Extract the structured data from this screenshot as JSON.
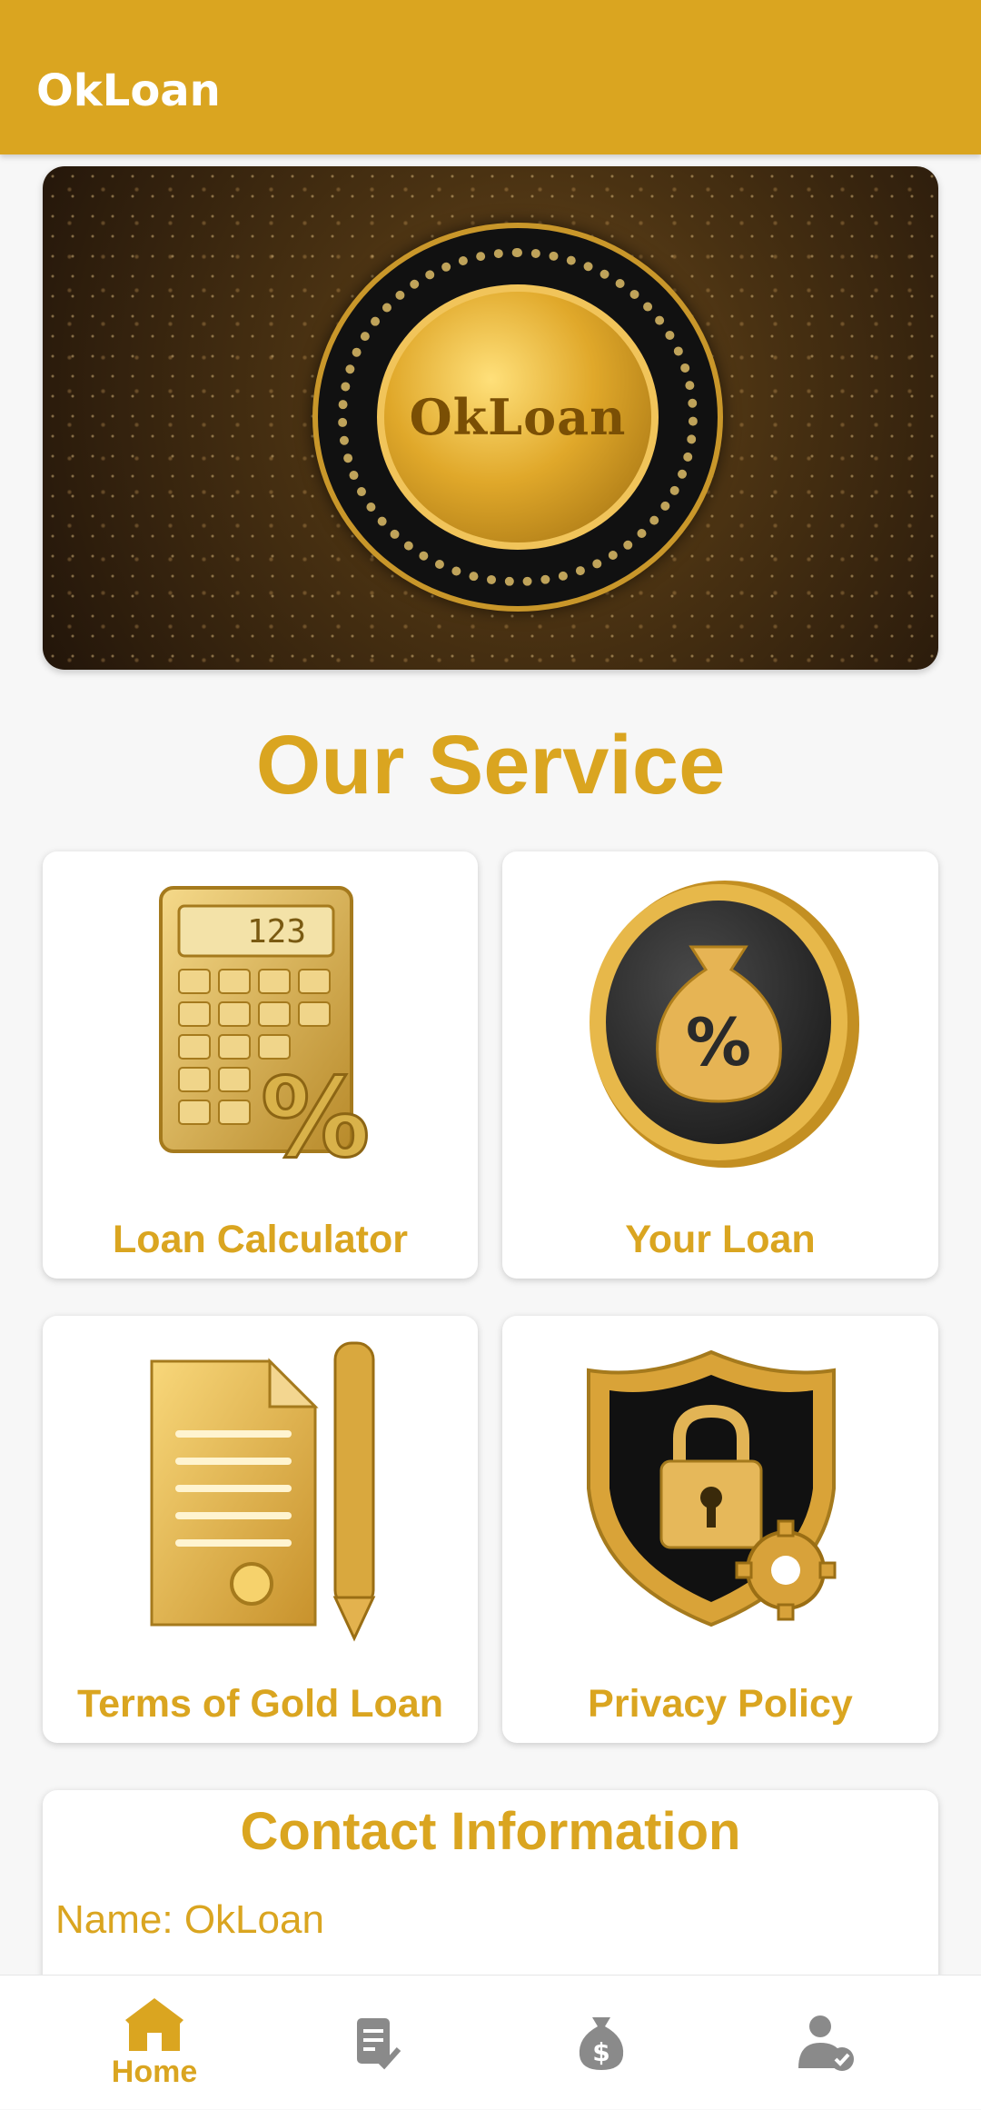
{
  "app": {
    "title": "OkLoan"
  },
  "banner": {
    "coin_text": "OkLoan"
  },
  "section": {
    "title": "Our Service"
  },
  "services": [
    {
      "label": "Loan Calculator",
      "icon": "calculator-icon"
    },
    {
      "label": "Your Loan",
      "icon": "money-bag-coin-icon"
    },
    {
      "label": "Terms of Gold Loan",
      "icon": "document-pen-icon"
    },
    {
      "label": "Privacy Policy",
      "icon": "shield-lock-icon"
    }
  ],
  "contact": {
    "title": "Contact Information",
    "name": "Name: OkLoan"
  },
  "bottom_nav": [
    {
      "label": "Home",
      "icon": "home-icon",
      "active": true
    },
    {
      "label": "",
      "icon": "document-check-icon",
      "active": false
    },
    {
      "label": "",
      "icon": "money-bag-icon",
      "active": false
    },
    {
      "label": "",
      "icon": "user-check-icon",
      "active": false
    }
  ],
  "colors": {
    "accent": "#daa520",
    "inactive_icon": "#8a8a8a"
  }
}
